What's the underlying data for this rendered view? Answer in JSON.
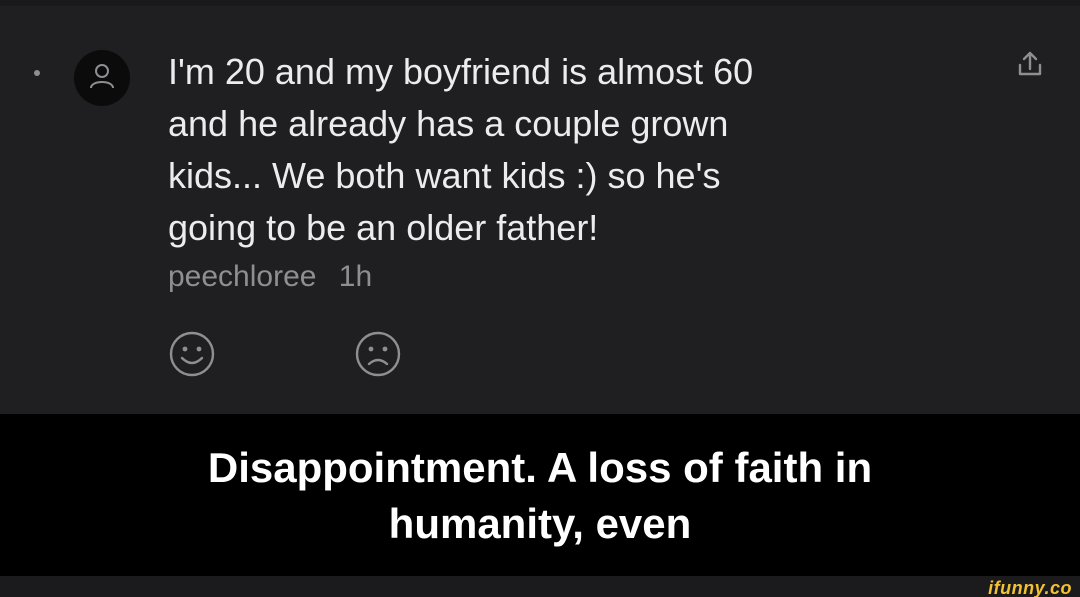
{
  "post": {
    "text": "I'm 20 and my boyfriend is almost 60\nand he already has a couple grown\nkids... We both want kids :) so he's\ngoing to be an older father!",
    "author": "peechloree",
    "time": "1h",
    "icons": {
      "avatar": "user-icon",
      "share": "share-icon",
      "happy": "happy-face-icon",
      "sad": "sad-face-icon"
    }
  },
  "caption": {
    "text": "Disappointment. A loss of faith in\nhumanity, even"
  },
  "watermark": {
    "text": "ifunny.co"
  },
  "colors": {
    "post_bg": "#1f1f21",
    "text": "#ececee",
    "meta": "#8e8e93",
    "caption_bg": "#000000",
    "watermark": "#f2c230"
  }
}
